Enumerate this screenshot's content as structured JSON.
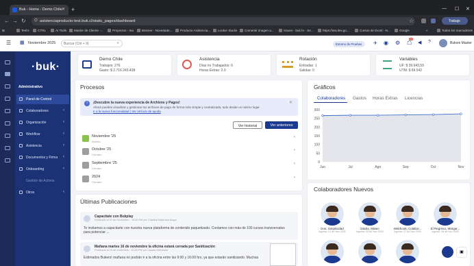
{
  "browser": {
    "tab_title": "Buk - Home - Demo Chile",
    "url": "asistenciaproducto-test.buk.cl/static_pages/dashboard",
    "profile_label": "Trabajo",
    "bookmarks": [
      "Test's",
      "CTRL",
      "AI Tools",
      "Master de Cliente -...",
      "Proyectos - Ina",
      "Bssmer - Novedade...",
      "Producto Asistencia...",
      "Looker Studio",
      "Comentir imagen a...",
      "Issues - buk.hr - Se...",
      "https://ww.dev.go...",
      "Cursos de Excel - N...",
      "Google"
    ],
    "all_bookmarks": "Todos los marcadores"
  },
  "topbar": {
    "period": "Noviembre 2025",
    "search_placeholder": "Buscar (Ctrl + 9)",
    "environment": "Entorno de Pruebas",
    "user_name": "Bukoni Master",
    "badge_count": "24"
  },
  "menu": {
    "logo": "·buk·",
    "section": "Administrativo",
    "items": [
      {
        "label": "Panel de Control",
        "chevron": false
      },
      {
        "label": "Colaboradores",
        "chevron": true
      },
      {
        "label": "Organización",
        "chevron": true
      },
      {
        "label": "Workflow",
        "chevron": true
      },
      {
        "label": "Asistencia",
        "chevron": true
      },
      {
        "label": "Documentos y Firma",
        "chevron": true
      },
      {
        "label": "Onboarding",
        "chevron": true
      },
      {
        "label": "Gestión de Activos",
        "chevron": false
      },
      {
        "label": "Otros",
        "chevron": true
      }
    ]
  },
  "summary": [
    {
      "title": "Demo Chile",
      "line1": "Trabajos: 276",
      "line2": "Gasto: $ 2.716.243.438",
      "color": "#1b3a8f"
    },
    {
      "title": "Asistencia",
      "line1": "Días no Trabajados: 6",
      "line2": "Horas Extras: 2.0",
      "color": "#e0584b"
    },
    {
      "title": "Rotación",
      "line1": "Entradas: 1",
      "line2": "Salidas: 0",
      "color": "#d89b2c"
    },
    {
      "title": "Variables",
      "line1": "UF: $ 39.643,59",
      "line2": "UTM: $ 69.542",
      "color": "#3aa57a"
    }
  ],
  "procesos": {
    "title": "Procesos",
    "banner_title": "¡Descubre la nueva experiencia de Archivos y Pagos!",
    "banner_text": "Ahora puedes visualizar y gestionar tus archivos de pago de forma más simple y centralizada, todo desde un mismo lugar",
    "banner_link": "Ir a la nueva funcionalidad | Ver artículo de ayuda",
    "btn_history": "Ver historial",
    "btn_previous": "Ver anteriores",
    "items": [
      {
        "name": "Noviembre '25",
        "status": "Abierto",
        "color": "#8bc34a"
      },
      {
        "name": "Octubre '25",
        "status": "Cerrado",
        "color": "#9e9e9e"
      },
      {
        "name": "Septiembre '25",
        "status": "Cerrado",
        "color": "#9e9e9e"
      },
      {
        "name": "2024",
        "status": "Cerrado",
        "color": "#9e9e9e"
      }
    ]
  },
  "publicaciones": {
    "title": "Últimas Publicaciones",
    "items": [
      {
        "headline": "Capacítate con Bukplay",
        "meta": "Publicado el 01 de Noviembre - 10:40 PM por Catalina Maturana Araya",
        "body": "Te invitamos a capacitarte con nuestra nueva plataforma de contenido paquetizado. Contamos con más de 100 cursos transversales para potenciar ..."
      },
      {
        "headline": "Mañana martes 16 de noviembre la oficina estará cerrada por Sanitización",
        "meta": "Publicado el 15 de noviembre - 10:40 PM por Usuario Bienestar",
        "body": "Estimados Bukers! mañana no podrán ir a la oficina entre las 9:00 y 16:00 hrs, ya que estarán sanitizando. Muchas"
      }
    ]
  },
  "graficos": {
    "title": "Gráficos",
    "tabs": [
      "Colaboradores",
      "Gastos",
      "Horas Extras",
      "Licencias"
    ]
  },
  "chart_data": {
    "type": "area",
    "categories": [
      "Jun",
      "Jul",
      "Ago",
      "Sep",
      "Oct",
      "Nov"
    ],
    "values": [
      266,
      268,
      268,
      270,
      272,
      276
    ],
    "title": "",
    "xlabel": "",
    "ylabel": "",
    "ylim": [
      0,
      300
    ],
    "yticks": [
      0,
      50,
      100,
      150,
      200,
      250,
      300
    ]
  },
  "nuevos": {
    "title": "Colaboradores Nuevos",
    "people": [
      {
        "name": "Dos, Simplicidad",
        "date": "Ingreso: 01 de Nov 2025"
      },
      {
        "name": "Dávila, Mateo",
        "date": "Ingreso: 03 de Nov 2025"
      },
      {
        "name": "Webhook, Colabor...",
        "date": "Ingreso: 07 de Nov 2025"
      },
      {
        "name": "El Regreso, Margar...",
        "date": "Ingreso: 08 de Nov 2025"
      }
    ]
  }
}
